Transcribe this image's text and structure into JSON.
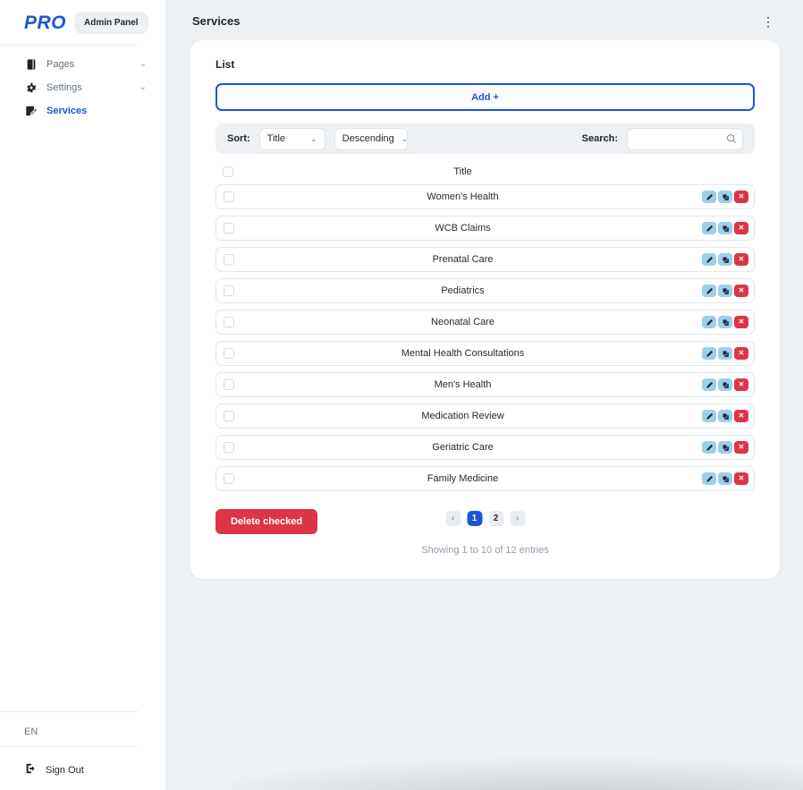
{
  "colors": {
    "primary": "#1a56db",
    "danger": "#dc3545",
    "action_blue": "#9fcfe8",
    "main_bg": "#edf1f4",
    "text": "#212b36"
  },
  "icons": {
    "kebab": "⋮",
    "chevron_down": "⌄",
    "prev_arrow": "‹",
    "next_arrow": "›",
    "close": "✕"
  },
  "sidebar": {
    "logo": "PRO",
    "badge": "Admin Panel",
    "items": [
      {
        "label": "Pages",
        "icon": "book-icon",
        "expandable": true,
        "active": false
      },
      {
        "label": "Settings",
        "icon": "gear-icon",
        "expandable": true,
        "active": false
      },
      {
        "label": "Services",
        "icon": "edit-note-icon",
        "expandable": false,
        "active": true
      }
    ],
    "language": "EN",
    "sign_out": "Sign Out"
  },
  "header": {
    "title": "Services"
  },
  "card": {
    "title": "List",
    "add_button_label": "Add +",
    "toolbar": {
      "sort_label": "Sort:",
      "sort_field_selected": "Title",
      "sort_direction_selected": "Descending",
      "search_label": "Search:",
      "search_value": ""
    },
    "table": {
      "header_title": "Title",
      "rows": [
        "Women's Health",
        "WCB Claims",
        "Prenatal Care",
        "Pediatrics",
        "Neonatal Care",
        "Mental Health Consultations",
        "Men's Health",
        "Medication Review",
        "Geriatric Care",
        "Family Medicine"
      ]
    },
    "delete_button_label": "Delete checked",
    "pagination": {
      "pages": [
        "1",
        "2"
      ],
      "active_page": "1"
    },
    "summary": "Showing 1 to 10 of 12 entries"
  }
}
